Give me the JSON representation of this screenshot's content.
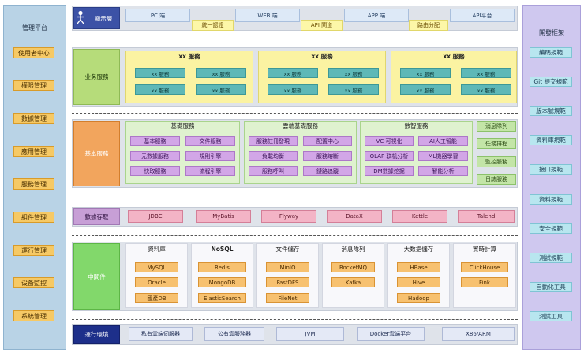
{
  "left_panel": {
    "title": "管理平台",
    "items": [
      "使用者中心",
      "權限管理",
      "數據管理",
      "應用管理",
      "服務管理",
      "組件管理",
      "運行管理",
      "设备監控",
      "系統管理"
    ]
  },
  "right_panel": {
    "title": "開發框架",
    "items": [
      "編碼規範",
      "Git 提交規範",
      "版本號規範",
      "資料庫規範",
      "接口規範",
      "資料規範",
      "安全規範",
      "測試規範",
      "自動化工具",
      "測試工具"
    ]
  },
  "display": {
    "label": "顯示層",
    "clients": [
      "PC 端",
      "WEB 端",
      "APP 端",
      "API平台"
    ],
    "gateways": [
      "統一認證",
      "API 閘道",
      "路由分配"
    ]
  },
  "business": {
    "label": "业务服務",
    "groups": [
      {
        "title": "xx 服務",
        "items": [
          "xx 服務",
          "xx 服務",
          "xx 服務",
          "xx 服務"
        ]
      },
      {
        "title": "xx 服務",
        "items": [
          "xx 服務",
          "xx 服務",
          "xx 服務",
          "xx 服務"
        ]
      },
      {
        "title": "xx 服務",
        "items": [
          "xx 服務",
          "xx 服務",
          "xx 服務",
          "xx 服務"
        ]
      }
    ]
  },
  "basic": {
    "label": "基本服務",
    "groups": [
      {
        "title": "基礎服務",
        "items": [
          "基本服務",
          "文件服務",
          "元數據服務",
          "規則引擎",
          "快取服務",
          "流程引擎"
        ]
      },
      {
        "title": "雲端基礎服務",
        "items": [
          "服務註冊發現",
          "配置中心",
          "負載均衡",
          "服務熔斷",
          "服務呼叫",
          "鏈路追蹤"
        ]
      },
      {
        "title": "數智服務",
        "items": [
          "VC 可視化",
          "AI人工智能",
          "OLAP 联机分析",
          "ML機器學習",
          "DM數據挖掘",
          "智能分析"
        ]
      }
    ],
    "side": [
      "消息隊列",
      "任務排程",
      "監控服務",
      "日誌服務"
    ]
  },
  "storage": {
    "label": "數據存取",
    "items": [
      "JDBC",
      "MyBatis",
      "Flyway",
      "DataX",
      "Kettle",
      "Talend"
    ]
  },
  "middleware": {
    "label": "中間件",
    "groups": [
      {
        "title": "資料庫",
        "items": [
          "MySQL",
          "Oracle",
          "國產DB"
        ]
      },
      {
        "title": "NoSQL",
        "items": [
          "Redis",
          "MongoDB",
          "ElasticSearch"
        ]
      },
      {
        "title": "文件儲存",
        "items": [
          "MinIO",
          "FastDFS",
          "FileNet"
        ]
      },
      {
        "title": "消息隊列",
        "items": [
          "RocketMQ",
          "Kafka"
        ]
      },
      {
        "title": "大数据儲存",
        "items": [
          "HBase",
          "Hive",
          "Hadoop"
        ]
      },
      {
        "title": "實時計算",
        "items": [
          "ClickHouse",
          "Fink"
        ]
      }
    ]
  },
  "runtime": {
    "label": "運行環境",
    "items": [
      "私有雲端伺服器",
      "公有雲服務器",
      "JVM",
      "Docker雲端平台",
      "X86/ARM"
    ]
  },
  "colors": {
    "left_panel": "#b9d3e6",
    "right_panel": "#cfc8ef",
    "accent_orange": "#f6c965",
    "business_label": "#b6dc7a",
    "basic_label": "#f2a55d",
    "storage_label": "#c79fd6",
    "middleware_label": "#82d86b",
    "runtime_label": "#1d2f8a"
  }
}
